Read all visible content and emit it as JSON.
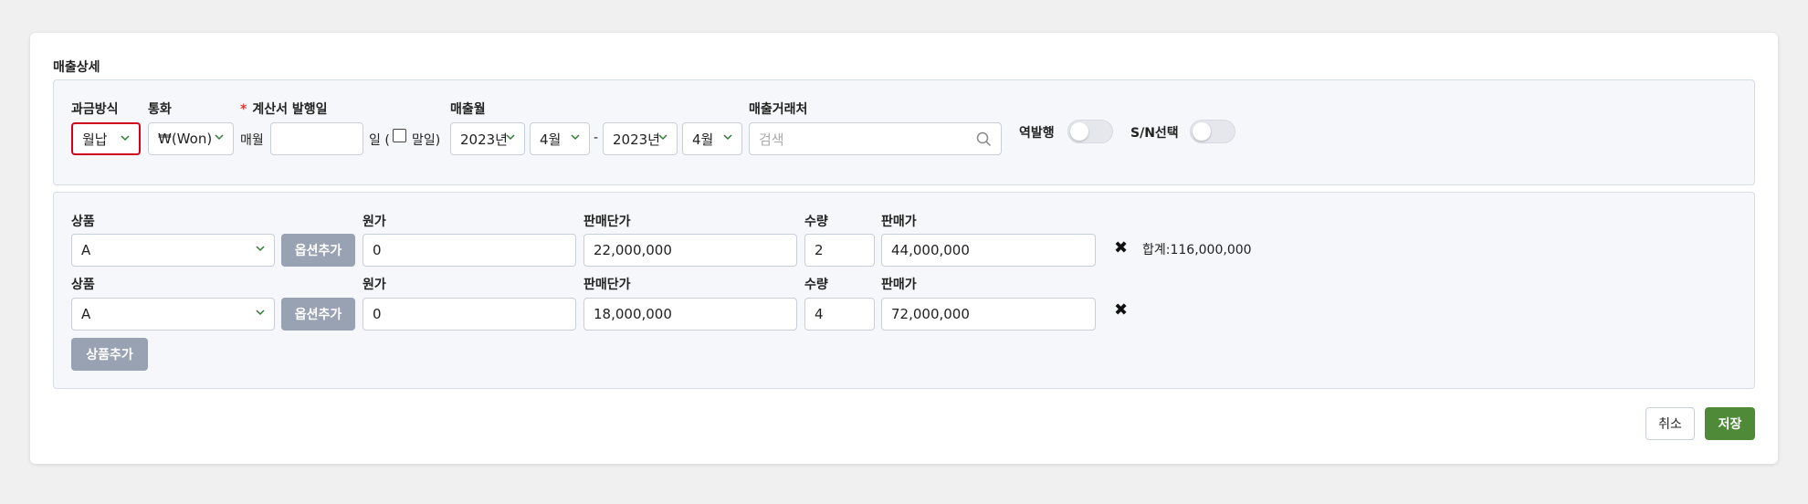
{
  "section_title": "매출상세",
  "filters": {
    "billing_label": "과금방식",
    "billing_value": "월납",
    "currency_label": "통화",
    "currency_value": "₩(Won)",
    "invoice_label": "계산서 발행일",
    "invoice_prefix": "매월",
    "invoice_day_value": "",
    "invoice_suffix": "일 (",
    "last_day_label": "말일)",
    "sales_month_label": "매출월",
    "start_year": "2023년",
    "start_month": "4월",
    "range_sep": "-",
    "end_year": "2023년",
    "end_month": "4월",
    "client_label": "매출거래처",
    "client_placeholder": "검색",
    "reverse_label": "역발행",
    "sn_label": "S/N선택"
  },
  "product_headers": {
    "product": "상품",
    "cost": "원가",
    "unit_price": "판매단가",
    "qty": "수량",
    "sale_price": "판매가"
  },
  "products": [
    {
      "product": "A",
      "option_button": "옵션추가",
      "cost": "0",
      "unit_price": "22,000,000",
      "qty": "2",
      "sale_price": "44,000,000",
      "remove": "✖"
    },
    {
      "product": "A",
      "option_button": "옵션추가",
      "cost": "0",
      "unit_price": "18,000,000",
      "qty": "4",
      "sale_price": "72,000,000",
      "remove": "✖"
    }
  ],
  "total_text": "합계:116,000,000",
  "add_product_button": "상품추가",
  "cancel_button": "취소",
  "save_button": "저장",
  "colors": {
    "save": "#4e8a37",
    "focus_border": "#d0021b",
    "grey_button": "#98a2b3"
  },
  "icons": {
    "caret": "chevron-down-icon",
    "search": "search-icon",
    "remove": "close-icon"
  }
}
